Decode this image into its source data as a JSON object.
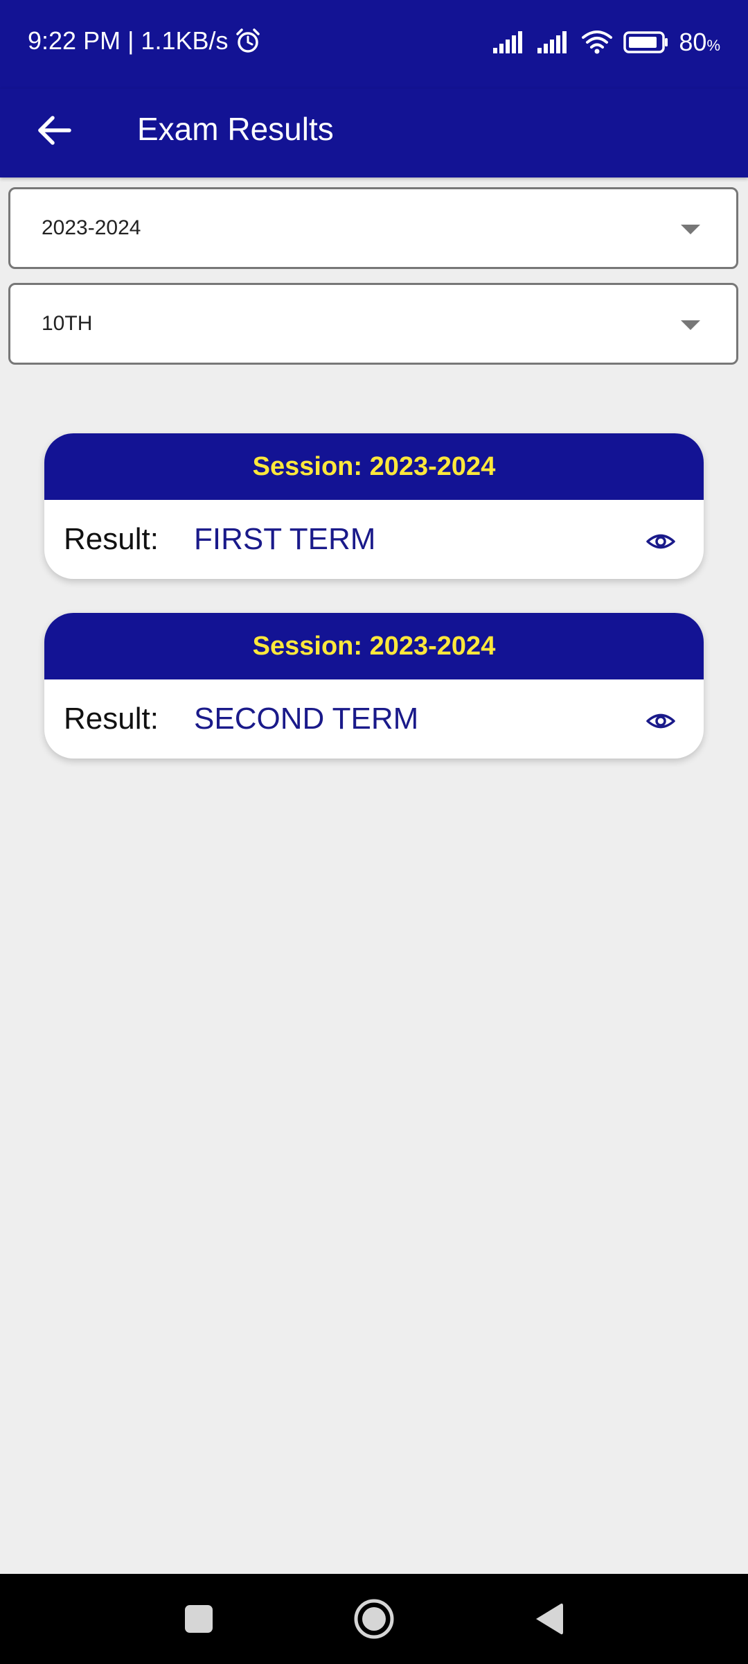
{
  "status_bar": {
    "time_speed": "9:22 PM | 1.1KB/s",
    "battery": "80",
    "battery_unit": "%"
  },
  "app_bar": {
    "title": "Exam Results"
  },
  "filters": {
    "session_value": "2023-2024",
    "class_value": "10TH"
  },
  "results": [
    {
      "session": "Session: 2023-2024",
      "label": "Result:",
      "term": "FIRST TERM"
    },
    {
      "session": "Session: 2023-2024",
      "label": "Result:",
      "term": "SECOND TERM"
    }
  ],
  "colors": {
    "primary": "#131394",
    "session_text": "#ffe83b",
    "term_text": "#1a1a8a",
    "background": "#eeeeee"
  },
  "icons": {
    "back": "arrow-left-icon",
    "view": "eye-icon",
    "alarm": "alarm-icon",
    "signal": "signal-icon",
    "wifi": "wifi-icon",
    "battery": "battery-icon",
    "nav_recents": "square-icon",
    "nav_home": "circle-icon",
    "nav_back": "triangle-icon"
  }
}
